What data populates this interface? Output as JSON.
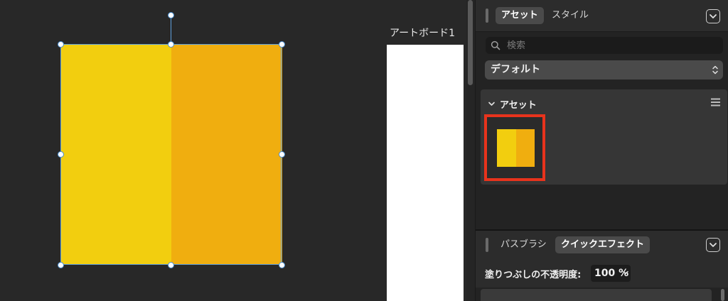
{
  "canvas": {
    "artboard_label": "アートボード1",
    "shape": {
      "left_color": "#F2CE0F",
      "right_color": "#F0AE0F",
      "selection_color": "#5FA0DC"
    }
  },
  "panel": {
    "tabs": [
      {
        "label": "アセット",
        "active": true
      },
      {
        "label": "スタイル",
        "active": false
      }
    ],
    "search": {
      "placeholder": "検索",
      "value": ""
    },
    "library_select": {
      "value": "デフォルト"
    },
    "assets_section": {
      "title": "アセット",
      "highlight_color": "#E8331C"
    }
  },
  "panel2": {
    "tabs": [
      {
        "label": "パスブラシ",
        "active": false
      },
      {
        "label": "クイックエフェクト",
        "active": true
      }
    ],
    "opacity_label": "塗りつぶしの不透明度:",
    "opacity_value": "100 %"
  },
  "icons": [
    "search-icon",
    "chevron-down-icon",
    "stepper-arrows-icon",
    "hamburger-menu-icon",
    "collapse-panel-icon"
  ]
}
